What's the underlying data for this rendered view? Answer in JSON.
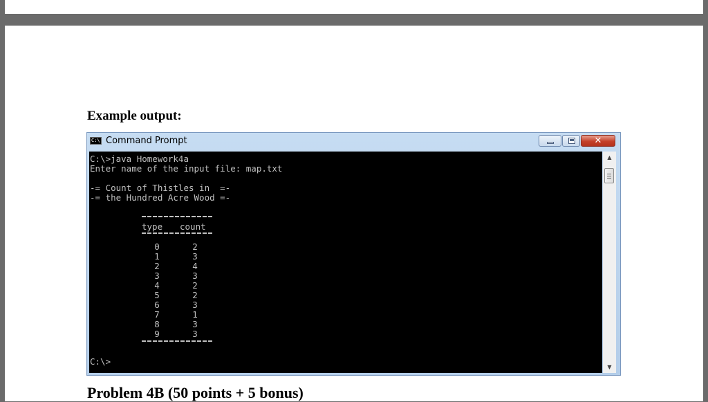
{
  "document": {
    "heading": "Example output:",
    "next_section": "Problem 4B (50 points + 5 bonus)"
  },
  "window": {
    "title": "Command Prompt",
    "icon": "cmd-icon",
    "icon_text": "C:\\",
    "close_glyph": "✕"
  },
  "console": {
    "lines": [
      "C:\\>java Homework4a",
      "Enter name of the input file: map.txt",
      "-= Count of Thistles in  =-",
      "-= the Hundred Acre Wood =-"
    ],
    "table": {
      "headers": [
        "type",
        "count"
      ],
      "rows": [
        [
          "0",
          "2"
        ],
        [
          "1",
          "3"
        ],
        [
          "2",
          "4"
        ],
        [
          "3",
          "3"
        ],
        [
          "4",
          "2"
        ],
        [
          "5",
          "2"
        ],
        [
          "6",
          "3"
        ],
        [
          "7",
          "1"
        ],
        [
          "8",
          "3"
        ],
        [
          "9",
          "3"
        ]
      ]
    },
    "prompt": "C:\\>"
  },
  "scrollbar": {
    "up_glyph": "▲",
    "down_glyph": "▼"
  }
}
